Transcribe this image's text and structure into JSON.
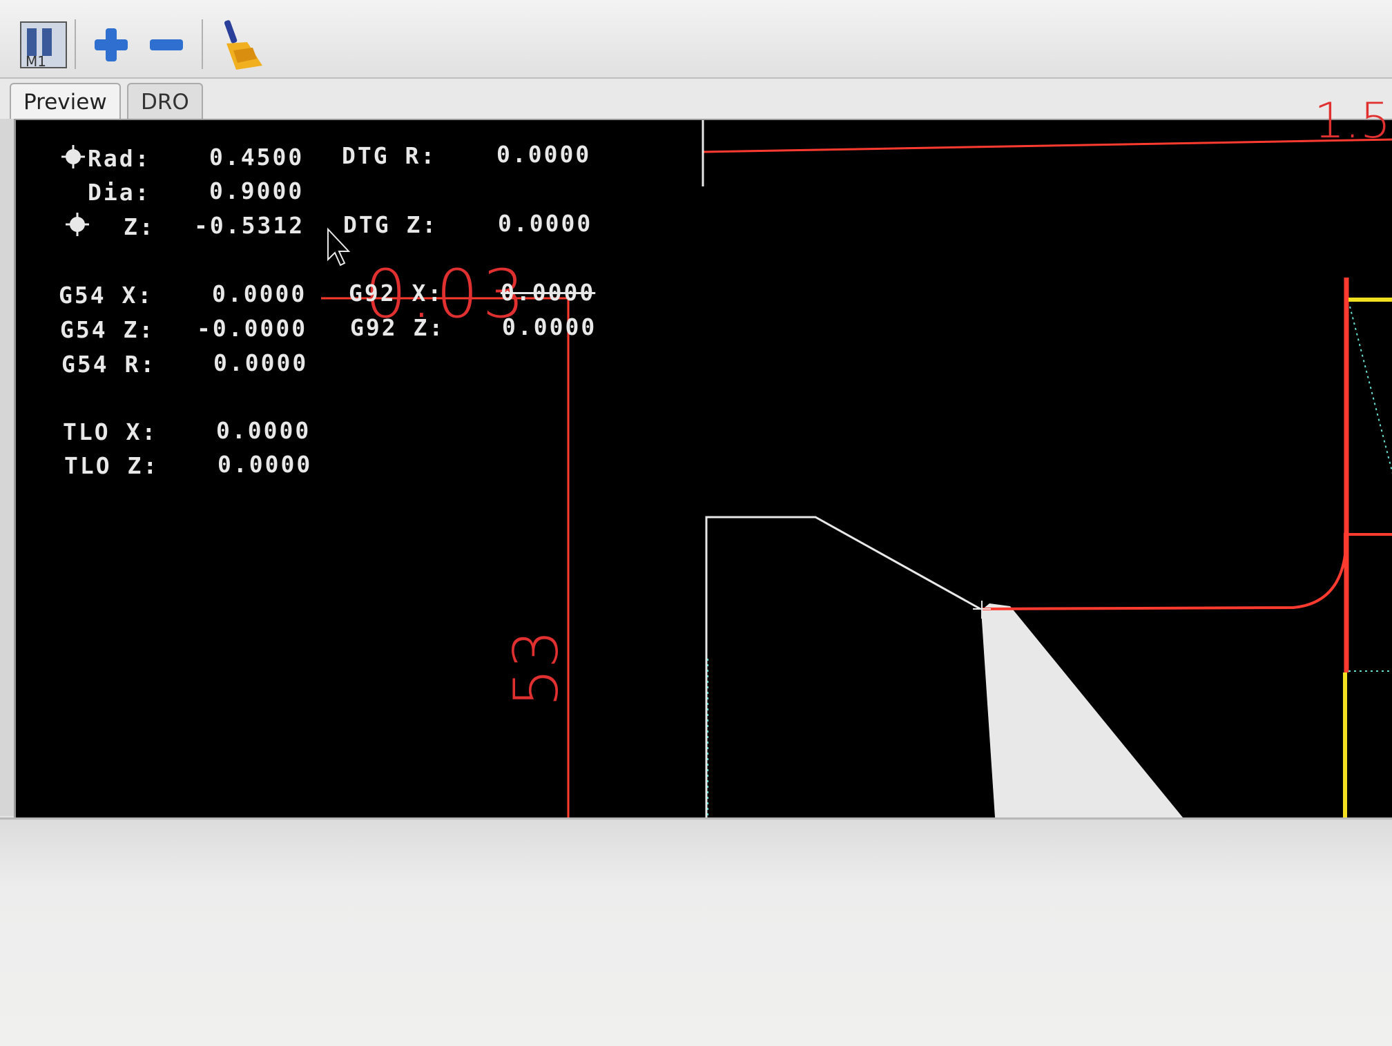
{
  "toolbar": {
    "buttons": [
      {
        "name": "optional-stop",
        "icon": "m1-optional-stop-icon",
        "label": "M1"
      },
      {
        "name": "zoom-in",
        "icon": "plus-icon"
      },
      {
        "name": "zoom-out",
        "icon": "minus-icon"
      },
      {
        "name": "clear-backplot",
        "icon": "broom-icon"
      }
    ]
  },
  "tabs": [
    {
      "label": "Preview",
      "active": true
    },
    {
      "label": "DRO",
      "active": false
    }
  ],
  "dro": {
    "rad_label": "Rad:",
    "rad_value": "0.4500",
    "dia_label": "Dia:",
    "dia_value": "0.9000",
    "z_label": "Z:",
    "z_value": "-0.5312",
    "dtg_r_label": "DTG R:",
    "dtg_r_value": "0.0000",
    "dtg_z_label": "DTG Z:",
    "dtg_z_value": "0.0000",
    "g54_x_label": "G54 X:",
    "g54_x_value": "0.0000",
    "g54_z_label": "G54 Z:",
    "g54_z_value": "-0.0000",
    "g54_r_label": "G54 R:",
    "g54_r_value": "0.0000",
    "g92_x_label": "G92 X:",
    "g92_x_value": "0.0000",
    "g92_z_label": "G92 Z:",
    "g92_z_value": "0.0000",
    "tlo_x_label": "TLO X:",
    "tlo_x_value": "0.0000",
    "tlo_z_label": "TLO Z:",
    "tlo_z_value": "0.0000"
  },
  "preview": {
    "dimension_top": "1.5",
    "dimension_diameter": "0.03",
    "dimension_side": "53",
    "colors": {
      "background": "#000000",
      "toolpath_feed": "#ff3b30",
      "toolpath_rapid": "#66e0d0",
      "limits": "#f0e020",
      "tool": "#e8e8e8"
    }
  }
}
